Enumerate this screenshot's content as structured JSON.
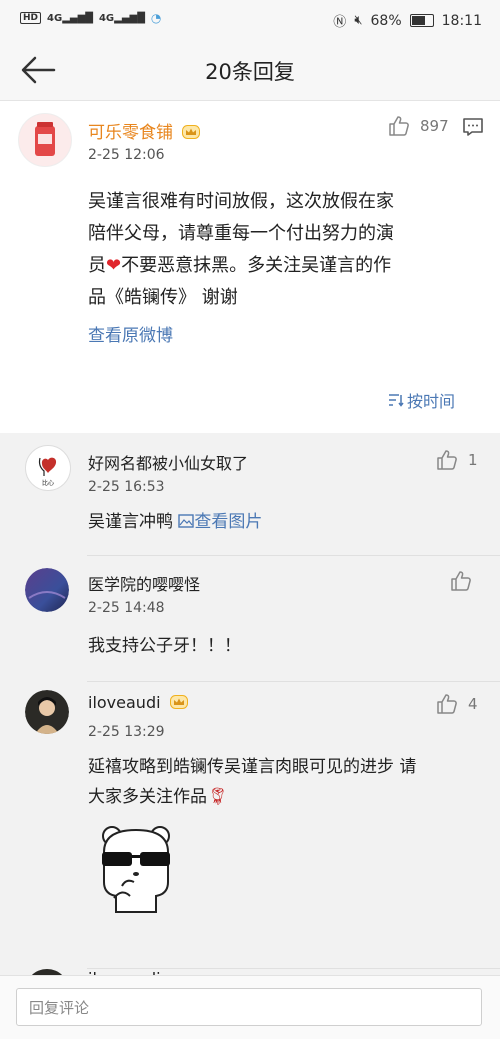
{
  "status": {
    "left_badge": "HD",
    "signal1": "4G",
    "signal2": "4G",
    "battery": "68%",
    "time": "18:11"
  },
  "header": {
    "title": "20条回复"
  },
  "main": {
    "author": "可乐零食铺",
    "time": "2-25 12:06",
    "likes": "897",
    "text_line1": "吴谨言很难有时间放假，这次放假在家",
    "text_line2": "陪伴父母，请尊重每一个付出努力的演",
    "text_line3a": "员",
    "text_line3b": "不要恶意抹黑。多关注吴谨言的作",
    "text_line4": "品《皓镧传》 谢谢",
    "view_original": "查看原微博",
    "sort_label": "按时间"
  },
  "replies": [
    {
      "author": "好网名都被小仙女取了",
      "time": "2-25 16:53",
      "likes": "1",
      "text": "吴谨言冲鸭",
      "image_link": "查看图片"
    },
    {
      "author": "医学院的嘤嘤怪",
      "time": "2-25 14:48",
      "likes": "",
      "text": "我支持公子牙！！！"
    },
    {
      "author": "iloveaudi",
      "time": "2-25 13:29",
      "likes": "4",
      "text_line1": "延禧攻略到皓镧传吴谨言肉眼可见的进步 请",
      "text_line2": "大家多关注作品"
    },
    {
      "author": "iloveaudi"
    }
  ],
  "input": {
    "placeholder": "回复评论"
  },
  "colors": {
    "author_orange": "#e8861e",
    "link_blue": "#4b78b4",
    "crown_gold": "#f0b11e"
  }
}
